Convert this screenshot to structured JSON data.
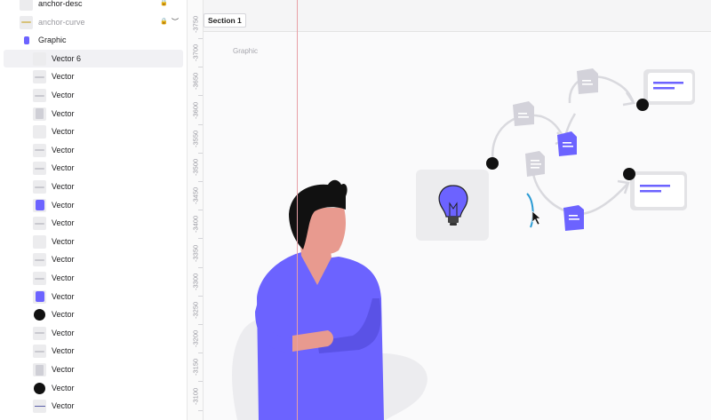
{
  "layers": [
    {
      "label": "anchor-desc",
      "thumb": "blank",
      "indent": 1,
      "lock": true
    },
    {
      "label": "anchor-curve",
      "thumb": "curve",
      "indent": 1,
      "lock": true,
      "hidden": true,
      "dim": true
    },
    {
      "label": "Graphic",
      "thumb": "graphic",
      "indent": 1
    },
    {
      "label": "Vector 6",
      "thumb": "blank",
      "indent": 2,
      "selected": true
    },
    {
      "label": "Vector",
      "thumb": "bar",
      "indent": 2
    },
    {
      "label": "Vector",
      "thumb": "bar",
      "indent": 2
    },
    {
      "label": "Vector",
      "thumb": "paper",
      "indent": 2
    },
    {
      "label": "Vector",
      "thumb": "blank",
      "indent": 2
    },
    {
      "label": "Vector",
      "thumb": "bar",
      "indent": 2
    },
    {
      "label": "Vector",
      "thumb": "bar",
      "indent": 2
    },
    {
      "label": "Vector",
      "thumb": "bar",
      "indent": 2
    },
    {
      "label": "Vector",
      "thumb": "purple",
      "indent": 2
    },
    {
      "label": "Vector",
      "thumb": "bar",
      "indent": 2
    },
    {
      "label": "Vector",
      "thumb": "blank",
      "indent": 2
    },
    {
      "label": "Vector",
      "thumb": "bar",
      "indent": 2
    },
    {
      "label": "Vector",
      "thumb": "bar",
      "indent": 2
    },
    {
      "label": "Vector",
      "thumb": "purple",
      "indent": 2
    },
    {
      "label": "Vector",
      "thumb": "dot",
      "indent": 2
    },
    {
      "label": "Vector",
      "thumb": "bar",
      "indent": 2
    },
    {
      "label": "Vector",
      "thumb": "bar",
      "indent": 2
    },
    {
      "label": "Vector",
      "thumb": "paper",
      "indent": 2
    },
    {
      "label": "Vector",
      "thumb": "dot",
      "indent": 2
    },
    {
      "label": "Vector",
      "thumb": "line",
      "indent": 2
    }
  ],
  "ruler_ticks": [
    "-3750",
    "-3700",
    "-3650",
    "-3600",
    "-3550",
    "-3500",
    "-3450",
    "-3400",
    "-3350",
    "-3300",
    "-3250",
    "-3200",
    "-3150",
    "-3100"
  ],
  "section": {
    "label": "Section 1"
  },
  "frame": {
    "label": "Graphic"
  },
  "colors": {
    "accent": "#6c63ff",
    "guide": "#e8a0a6",
    "skin": "#e89a8f",
    "hair": "#111111",
    "paper": "#d3d2da"
  }
}
